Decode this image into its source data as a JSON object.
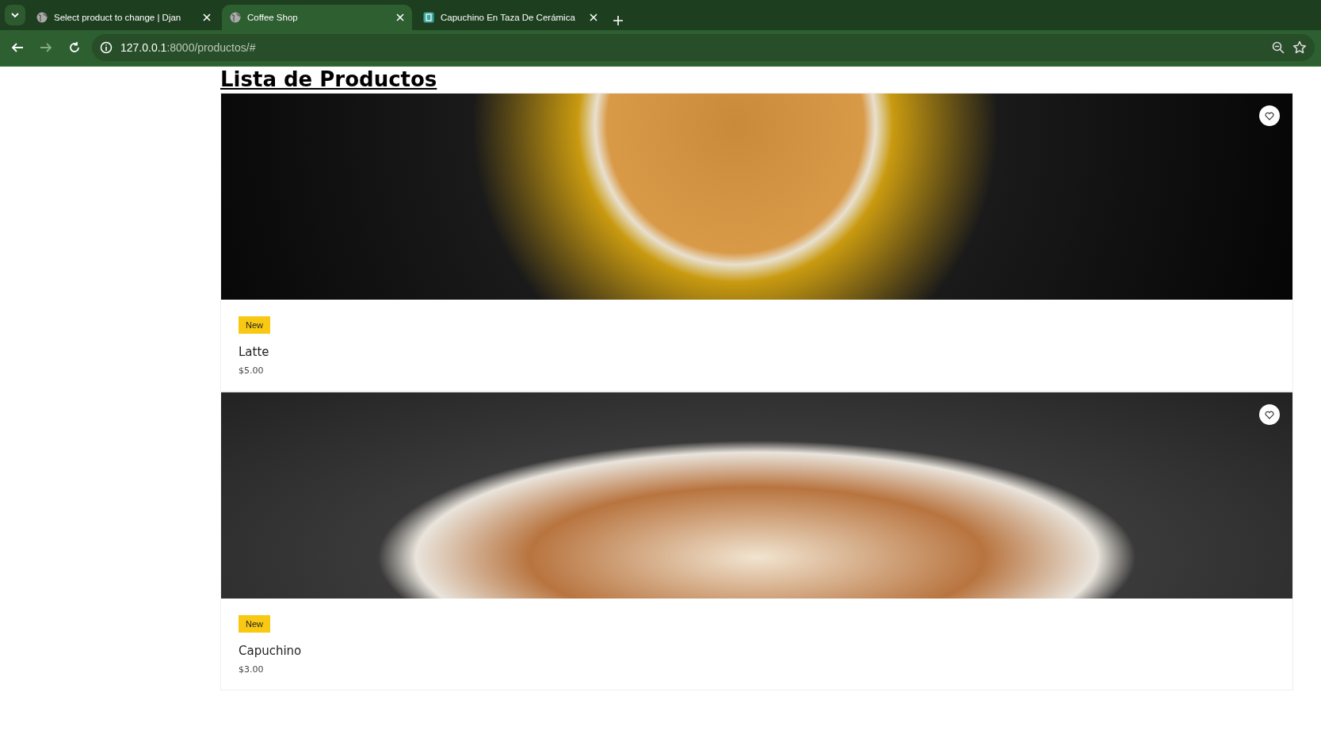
{
  "browser": {
    "tabs": [
      {
        "title": "Select product to change | Djan",
        "kind": "globe",
        "selected": false
      },
      {
        "title": "Coffee Shop",
        "kind": "globe",
        "selected": true
      },
      {
        "title": "Capuchino En Taza De Cerámica",
        "kind": "page",
        "selected": false
      }
    ],
    "address": {
      "host": "127.0.0.1",
      "path": ":8000/productos/#"
    }
  },
  "page": {
    "heading": "Lista de Productos",
    "products": [
      {
        "badge": "New",
        "name": "Latte",
        "price": "$5.00"
      },
      {
        "badge": "New",
        "name": "Capuchino",
        "price": "$3.00"
      }
    ]
  }
}
